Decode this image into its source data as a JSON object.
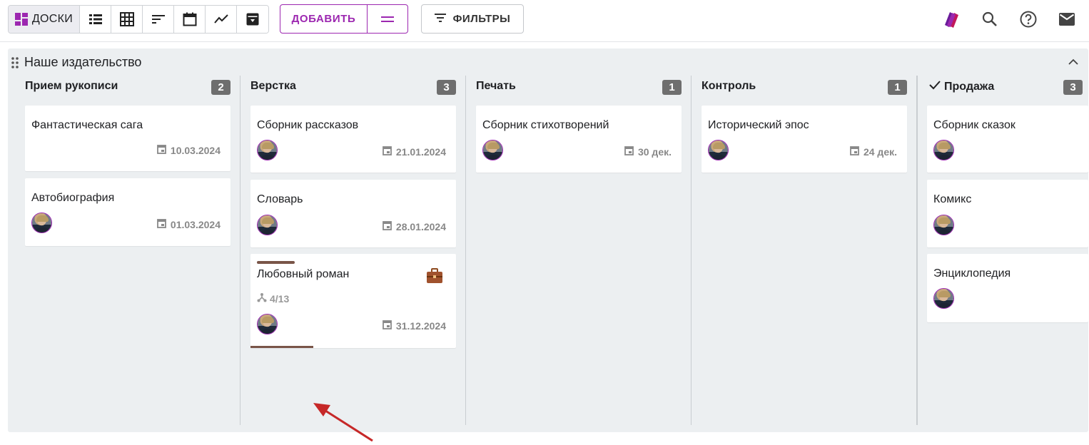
{
  "toolbar": {
    "views": {
      "boards": {
        "label": "ДОСКИ",
        "icon": "dashboard-icon",
        "active": true
      },
      "list": {
        "icon": "list-icon"
      },
      "table": {
        "icon": "grid-icon"
      },
      "gantt": {
        "icon": "sort-lines-icon"
      },
      "calendar": {
        "icon": "calendar-icon"
      },
      "chart": {
        "icon": "trend-line-icon"
      },
      "archive": {
        "icon": "archive-icon"
      }
    },
    "add_label": "ДОБАВИТЬ",
    "add_more_icon": "equals-icon",
    "filters_label": "ФИЛЬТРЫ",
    "right_icons": [
      "cards-brand-icon",
      "search-icon",
      "help-icon",
      "mail-icon"
    ]
  },
  "colors": {
    "accent": "#9c27b0",
    "board_bg": "#eceff1",
    "count_badge": "#6e6e6e",
    "progress": "#795548",
    "arrow": "#c62828",
    "briefcase": "#a0522d"
  },
  "board": {
    "title": "Наше издательство",
    "columns": [
      {
        "title": "Прием рукописи",
        "count": "2",
        "cards": [
          {
            "title": "Фантастическая сага",
            "date": "10.03.2024",
            "avatar": false
          },
          {
            "title": "Автобиография",
            "date": "01.03.2024",
            "avatar": true
          }
        ]
      },
      {
        "title": "Верстка",
        "count": "3",
        "cards": [
          {
            "title": "Сборник рассказов",
            "date": "21.01.2024",
            "avatar": true
          },
          {
            "title": "Словарь",
            "date": "28.01.2024",
            "avatar": true
          },
          {
            "title": "Любовный роман",
            "date": "31.12.2024",
            "avatar": true,
            "subtasks": "4/13",
            "progress": 0.3,
            "icon": "briefcase-icon"
          }
        ]
      },
      {
        "title": "Печать",
        "count": "1",
        "cards": [
          {
            "title": "Сборник стихотворений",
            "date": "30 дек.",
            "avatar": true
          }
        ]
      },
      {
        "title": "Контроль",
        "count": "1",
        "cards": [
          {
            "title": "Исторический эпос",
            "date": "24 дек.",
            "avatar": true
          }
        ]
      },
      {
        "title": "Продажа",
        "done": true,
        "count": "3",
        "cards": [
          {
            "title": "Сборник сказок",
            "avatar": true
          },
          {
            "title": "Комикс",
            "avatar": true
          },
          {
            "title": "Энциклопедия",
            "avatar": true
          }
        ]
      }
    ]
  }
}
